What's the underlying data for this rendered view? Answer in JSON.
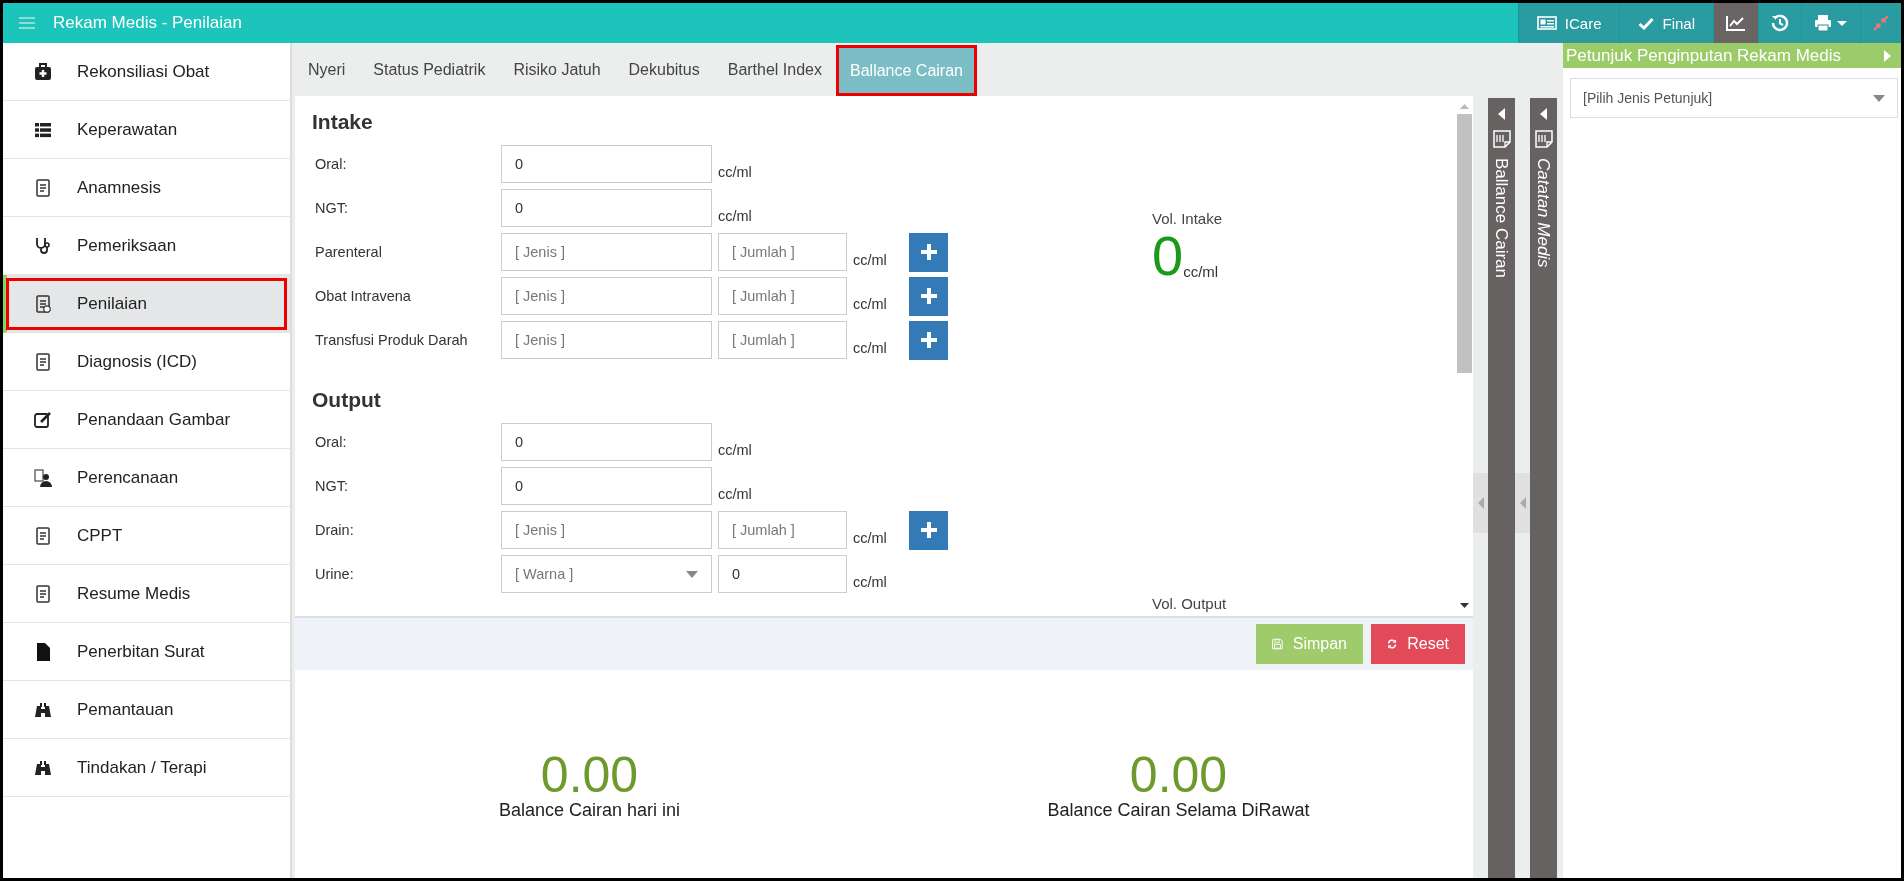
{
  "window": {
    "title": "Rekam Medis - Penilaian"
  },
  "toolbar": [
    {
      "kind": "text",
      "label": "ICare",
      "selected": false
    },
    {
      "kind": "text",
      "label": "Final",
      "selected": false
    },
    {
      "kind": "chart",
      "selected": true
    },
    {
      "kind": "history",
      "selected": false
    },
    {
      "kind": "print",
      "selected": false
    },
    {
      "kind": "collapse",
      "selected": false
    }
  ],
  "sidebar": {
    "items": [
      {
        "label": "Rekonsiliasi Obat",
        "selected": false
      },
      {
        "label": "Keperawatan",
        "selected": false
      },
      {
        "label": "Anamnesis",
        "selected": false
      },
      {
        "label": "Pemeriksaan",
        "selected": false
      },
      {
        "label": "Penilaian",
        "selected": true
      },
      {
        "label": "Diagnosis (ICD)",
        "selected": false
      },
      {
        "label": "Penandaan Gambar",
        "selected": false
      },
      {
        "label": "Perencanaan",
        "selected": false
      },
      {
        "label": "CPPT",
        "selected": false
      },
      {
        "label": "Resume Medis",
        "selected": false
      },
      {
        "label": "Penerbitan Surat",
        "selected": false
      },
      {
        "label": "Pemantauan",
        "selected": false
      },
      {
        "label": "Tindakan / Terapi",
        "selected": false
      }
    ]
  },
  "tabs": [
    {
      "label": "Nyeri",
      "selected": false
    },
    {
      "label": "Status Pediatrik",
      "selected": false
    },
    {
      "label": "Risiko Jatuh",
      "selected": false
    },
    {
      "label": "Dekubitus",
      "selected": false
    },
    {
      "label": "Barthel Index",
      "selected": false
    },
    {
      "label": "Ballance Cairan",
      "selected": true
    }
  ],
  "sections": [
    {
      "title": "Intake",
      "rows": [
        {
          "kind": "single",
          "label": "Oral:",
          "value": "0",
          "unit": "cc/ml"
        },
        {
          "kind": "single",
          "label": "NGT:",
          "value": "0",
          "unit": "cc/ml"
        },
        {
          "kind": "pair",
          "label": "Parenteral",
          "placeholder": "[ Jenis ]",
          "placeholder_2": "[ Jumlah ]",
          "unit": "cc/ml"
        },
        {
          "kind": "pair",
          "label": "Obat Intravena",
          "placeholder": "[ Jenis ]",
          "placeholder_2": "[ Jumlah ]",
          "unit": "cc/ml"
        },
        {
          "kind": "pair",
          "label": "Transfusi Produk Darah",
          "placeholder": "[ Jenis ]",
          "placeholder_2": "[ Jumlah ]",
          "unit": "cc/ml"
        }
      ]
    },
    {
      "title": "Output",
      "rows": [
        {
          "kind": "single",
          "label": "Oral:",
          "value": "0",
          "unit": "cc/ml"
        },
        {
          "kind": "single",
          "label": "NGT:",
          "value": "0",
          "unit": "cc/ml"
        },
        {
          "kind": "pair",
          "label": "Drain:",
          "placeholder": "[ Jenis ]",
          "placeholder_2": "[ Jumlah ]",
          "unit": "cc/ml"
        },
        {
          "kind": "select",
          "label": "Urine:",
          "placeholder": "[ Warna ]",
          "value": "0",
          "unit": "cc/ml"
        }
      ]
    }
  ],
  "vol_intake": {
    "label": "Vol. Intake",
    "value": "0",
    "unit": "cc/ml"
  },
  "vol_output": {
    "label": "Vol. Output"
  },
  "actions": [
    {
      "kind": "save",
      "label": "Simpan"
    },
    {
      "kind": "reset",
      "label": "Reset"
    }
  ],
  "summary": [
    {
      "value": "0.00",
      "label": "Balance Cairan hari ini"
    },
    {
      "value": "0.00",
      "label": "Balance Cairan Selama DiRawat"
    }
  ],
  "side_tabs": [
    {
      "label": "Ballance Cairan",
      "italic": false
    },
    {
      "label": "Catatan Medis",
      "italic": true
    }
  ],
  "guide_panel": {
    "title": "Petunjuk Penginputan Rekam Medis",
    "placeholder": "[Pilih Jenis Petunjuk]"
  }
}
